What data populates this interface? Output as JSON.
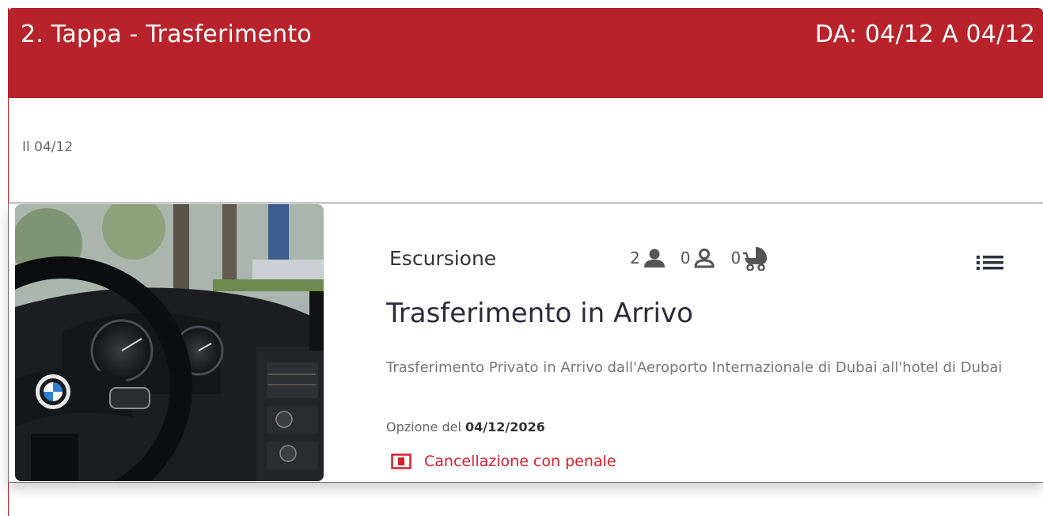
{
  "header": {
    "title": "2. Tappa - Trasferimento",
    "dates": "DA: 04/12 A 04/12",
    "background_color": "#b8232b"
  },
  "day": {
    "label": "Il 04/12"
  },
  "service": {
    "type": "Escursione",
    "pax": {
      "adults": "2",
      "children": "0",
      "infants": "0",
      "adult_icon": "person-filled-icon",
      "child_icon": "person-outline-icon",
      "infant_icon": "stroller-icon"
    },
    "menu_icon": "list-menu-icon",
    "title": "Trasferimento in Arrivo",
    "description": "Trasferimento Privato in Arrivo dall'Aeroporto Internazionale di Dubai all'hotel di Dubai",
    "option_prefix": "Opzione del ",
    "option_date": "04/12/2026",
    "cancellation": "Cancellazione con penale",
    "cancellation_color": "#d8202b",
    "image": "car-interior-steering-wheel-photo"
  }
}
